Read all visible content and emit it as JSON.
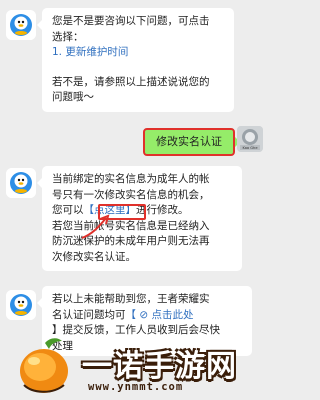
{
  "messages": [
    {
      "sender": "bot",
      "lines": [
        "您是不是要咨询以下问题，可点击",
        "选择：",
        "1. 更新维护时间",
        "",
        "若不是，请参照以上描述说说您的",
        "问题哦～"
      ]
    },
    {
      "sender": "user",
      "text": "修改实名认证"
    },
    {
      "sender": "bot",
      "lines_before": [
        "当前绑定的实名信息为成年人的帐",
        "号只有一次修改实名信息的机会，"
      ],
      "line_click_prefix": "您可以",
      "line_click_link": "【点这里】",
      "line_click_suffix": "进行修改。",
      "lines_after": [
        "若您当前帐号实名信息是已经纳入",
        "防沉迷保护的未成年用户则无法再",
        "次修改实名认证。"
      ]
    },
    {
      "sender": "bot",
      "line1": "若以上未能帮助到您，王者荣耀实",
      "line2_prefix": "名认证问题均可",
      "line2_link": "【 ⊘  点击此处",
      "line3": "】提交反馈，工作人员收到后会尽快",
      "line4": "处理"
    }
  ],
  "user_avatar_caption": "Kaa Ghe",
  "watermark": {
    "title": "一诺手游网",
    "url": "www.ynmmt.com"
  },
  "colors": {
    "background": "#ededed",
    "user_bubble": "#95ec69",
    "highlight": "#e0312b",
    "link": "#2f6fbf"
  }
}
